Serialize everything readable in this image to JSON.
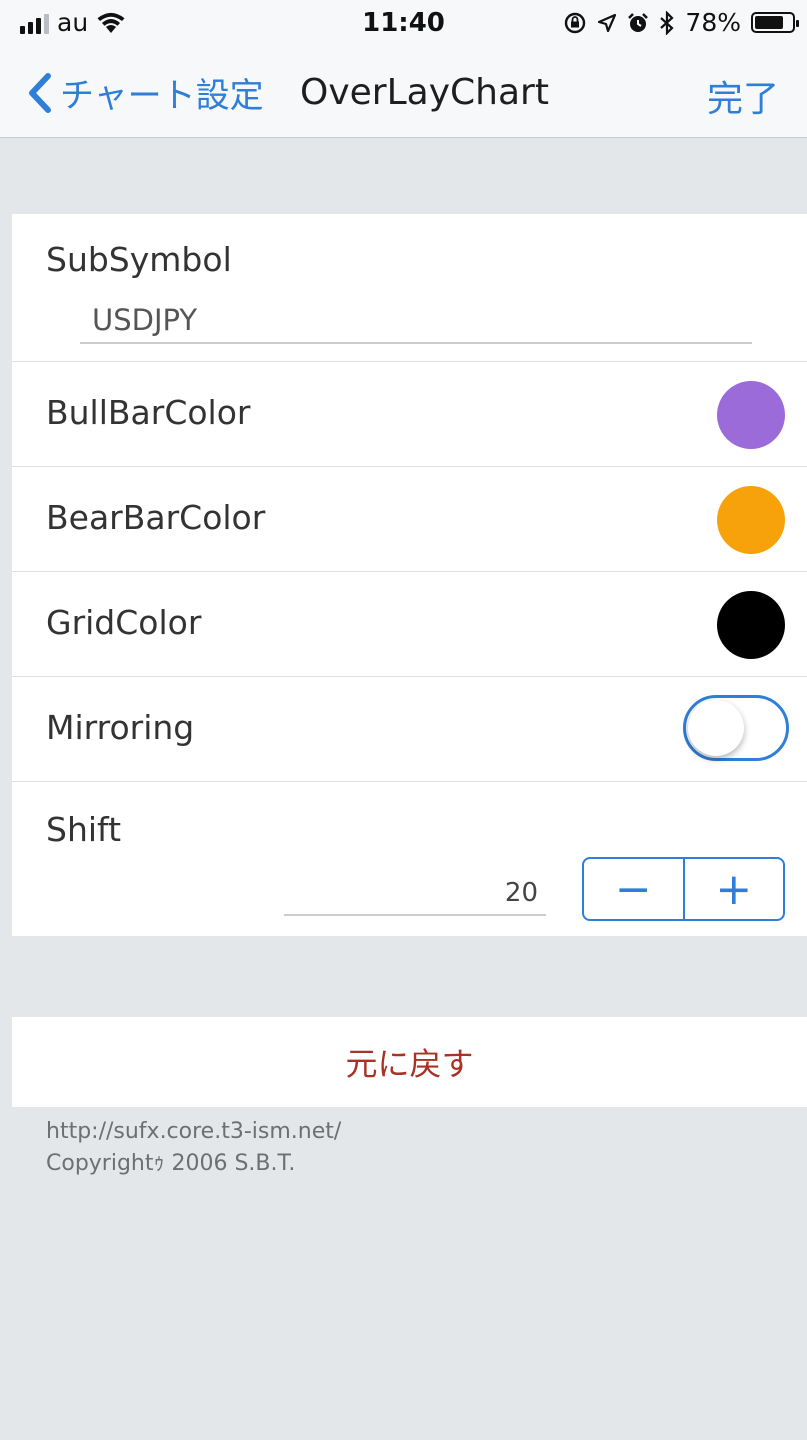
{
  "status_bar": {
    "carrier": "au",
    "time": "11:40",
    "battery_percent": "78%",
    "battery_level": 0.78,
    "icons": [
      "signal-icon",
      "wifi-icon",
      "lock-rotation-icon",
      "location-icon",
      "alarm-icon",
      "bluetooth-icon",
      "battery-icon"
    ]
  },
  "navbar": {
    "back_label": "チャート設定",
    "title": "OverLayChart",
    "done_label": "完了"
  },
  "settings": {
    "subsymbol": {
      "label": "SubSymbol",
      "value": "USDJPY"
    },
    "bull_bar_color": {
      "label": "BullBarColor",
      "color": "#9b6bd9"
    },
    "bear_bar_color": {
      "label": "BearBarColor",
      "color": "#f7a20a"
    },
    "grid_color": {
      "label": "GridColor",
      "color": "#000000"
    },
    "mirroring": {
      "label": "Mirroring",
      "on": false
    },
    "shift": {
      "label": "Shift",
      "value": "20",
      "minus": "−",
      "plus": "+"
    }
  },
  "reset": {
    "label": "元に戻す"
  },
  "footer": {
    "url": "http://sufx.core.t3-ism.net/",
    "copyright": "Copyrightｩ 2006 S.B.T."
  },
  "colors": {
    "accent": "#2f7ed8",
    "destructive": "#a93226",
    "background": "#e4e7ea"
  }
}
